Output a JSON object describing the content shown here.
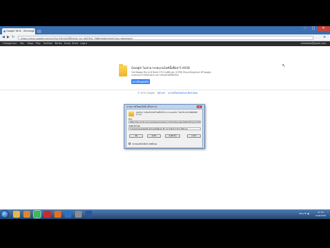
{
  "browser": {
    "tab_title": "Google Tarik - Semua D",
    "tab_close": "×",
    "url": "https://drive.google.com/u/0/sr/1Hm4z2fBkm2g_hq_dA2Ybd_7b6bmkAq/view?usp=download",
    "window_controls": {
      "minimize": "–",
      "maximize": "□",
      "close": "✕"
    },
    "nav": {
      "back": "◀",
      "forward": "▶",
      "reload": "↻",
      "menu": "≡"
    }
  },
  "google_bar": {
    "items": [
      "+Google",
      "Cari",
      "Gbr",
      "Maps",
      "Play",
      "YouTube",
      "Berita",
      "Gmail",
      "Drive",
      "Lagi ▾"
    ],
    "account": "sukarlaba@gmail.com"
  },
  "notice": {
    "title": "Google ไม่สามารถสแกนไฟล์นี้เพื่อหาไวรัสได้",
    "body": "ไฟล์ Nagao Pro v1.8 Build 1713 (x86).rar (157M) มีขนาดใหญ่เกินกว่าที่ Google จะสแกนหาไวรัสได้ ต้องการดาวน์โหลดไฟล์นี้หรือไม่",
    "button": "ดาวน์โหลดต่อไป",
    "footer_text": "© 2014 Google",
    "footer_links": [
      "หน้าแรก",
      "ความเป็นส่วนตัวและข้อกำหนด"
    ]
  },
  "dialog": {
    "title": "การดาวน์โหลดไฟล์ (ชั่วคราว)",
    "close": "X",
    "message": "คุณต้องการเปิดหรือบันทึกไฟล์นี้หรือไม่ ความปลอดภัย: ไฟล์ MS 28.3MB/NSEP (1.rar)",
    "from_label": "ที่มา:",
    "from_url": "https://doc-0c-6o-docs.googleusercontent.com/docs/securesc/ha0ro937gcuc7l7deffksulhg5h7mbp1/",
    "save_label": "บันทึกเป็นไฟล์:",
    "save_path": "C:\\Users\\sukarlaba\\Downloads\\Nagao Pro v1.8 Build 1713 (x86).rar",
    "buttons": [
      "เปิด",
      "บันทึก",
      "บันทึกเป็น",
      "ยกเลิก"
    ],
    "checkbox_label": "ถามก่อนเปิดไฟล์ประเภทนี้เสมอ"
  },
  "taskbar": {
    "apps": [
      {
        "icon": "explorer-icon",
        "color": "#e8b84a"
      },
      {
        "icon": "media-player-icon",
        "color": "#e0862a"
      },
      {
        "icon": "chrome-icon",
        "color": "#3cba54"
      },
      {
        "icon": "opera-icon",
        "color": "#cc2a2a"
      },
      {
        "icon": "firefox-icon",
        "color": "#e66f1e"
      },
      {
        "icon": "photoshop-icon",
        "color": "#2a72c8"
      },
      {
        "icon": "app-icon",
        "color": "#8c8c8c"
      },
      {
        "icon": "word-icon",
        "color": "#2b5797"
      }
    ],
    "tray_text": "EN ▴ ⚑ ◀)",
    "time": "21:59",
    "date": "10/8/2558"
  }
}
